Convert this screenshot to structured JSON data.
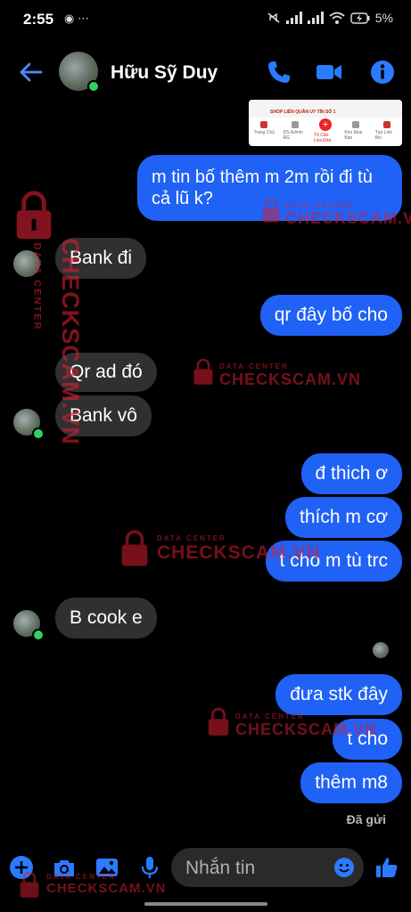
{
  "status_bar": {
    "time": "2:55",
    "left_icons": "◉ ⋯",
    "battery": "5%"
  },
  "header": {
    "contact_name": "Hữu Sỹ Duy"
  },
  "colors": {
    "accent": "#1f62f5",
    "incoming_bubble": "#303030",
    "online": "#31d160",
    "watermark": "#d71e32"
  },
  "shared_image": {
    "banner_text": "SHOP LIÊN QUÂN UY TÍN SỐ 1",
    "nav": [
      "Trang Chủ",
      "DS Admin ĐG",
      "Tố Cáo Lừa Đảo",
      "Kho Mua Bán",
      "Tạo Link Bio"
    ]
  },
  "messages": [
    {
      "dir": "out",
      "text": "m tin bố thêm m 2m rồi đi tù cả lũ k?"
    },
    {
      "dir": "in",
      "text": "Bank đi"
    },
    {
      "dir": "out",
      "text": "qr đây bố cho"
    },
    {
      "dir": "in",
      "text": "Qr ad đó"
    },
    {
      "dir": "in",
      "text": "Bank vô"
    },
    {
      "dir": "out",
      "text": "đ thich ơ"
    },
    {
      "dir": "out",
      "text": "thích m cơ"
    },
    {
      "dir": "out",
      "text": "t cho m tù trc"
    },
    {
      "dir": "in",
      "text": "B cook e"
    },
    {
      "dir": "out",
      "text": "đưa stk đây"
    },
    {
      "dir": "out",
      "text": "t cho"
    },
    {
      "dir": "out",
      "text": "thêm m8"
    }
  ],
  "sent_status": "Đã gửi",
  "composer": {
    "placeholder": "Nhắn tin"
  },
  "watermark": {
    "small": "DATA CENTER",
    "large": "CHECKSCAM.VN"
  },
  "icons": {
    "back": "back-arrow-icon",
    "call": "phone-icon",
    "video": "video-camera-icon",
    "info": "info-icon",
    "plus": "plus-icon",
    "camera": "camera-icon",
    "gallery": "image-icon",
    "mic": "microphone-icon",
    "emoji": "emoji-icon",
    "like": "thumbs-up-icon"
  }
}
